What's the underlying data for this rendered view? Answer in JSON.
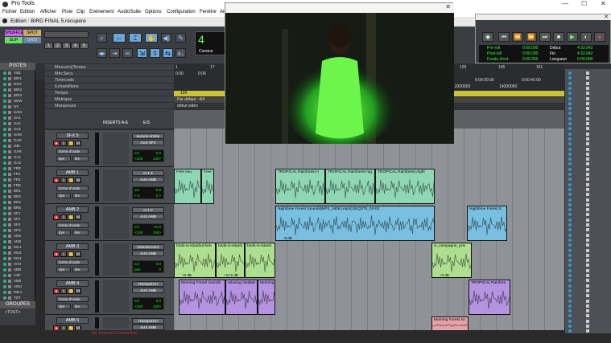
{
  "window": {
    "title": "Pro Tools",
    "controls": [
      "—",
      "☐",
      "✕"
    ]
  },
  "menu": [
    "Fichier",
    "Edition",
    "Afficher",
    "Piste",
    "Clip",
    "Evénement",
    "AudioSuite",
    "Options",
    "Configuration",
    "Fenêtre",
    "Aide"
  ],
  "edit_window": {
    "title": "Edition : BIRD FINAL 5.récupéré"
  },
  "toolbar": {
    "modes": [
      "SHUFFLE",
      "SPOT",
      "SLIP",
      "GRID"
    ],
    "zoom_presets": [
      "1",
      "2",
      "3",
      "4",
      "5"
    ],
    "counter_value": "4",
    "counter_label": "Curseur"
  },
  "tracks_panel": {
    "header": "PISTES",
    "tracks": [
      "Vid1",
      "BIR1",
      "DSG",
      "BIR2",
      "BIR3",
      "NEW",
      "NV",
      "SAM",
      "SA1",
      "SA2",
      "SA3",
      "SAM",
      "GAR",
      "GBI",
      "GAR",
      "GA1",
      "GA2",
      "FRE",
      "FR1",
      "FR2",
      "FRE",
      "BR1",
      "BR3",
      "BR4",
      "BRE",
      "SF1",
      "SF2",
      "SF4",
      "SFS",
      "AM1",
      "AM2",
      "MU1",
      "MU2",
      "MU3",
      "AVO",
      "ABR",
      "ASF",
      "AM0",
      "AMU",
      "Mar1",
      "TOT"
    ]
  },
  "groups_panel": {
    "header": "GROUPES",
    "item": "<TOUT>"
  },
  "rulers": [
    "Mesures|Temps",
    "Min:Secs",
    "Timecode",
    "Echantillons",
    "Tempo",
    "Métrique",
    "Marqueurs"
  ],
  "ruler_values": {
    "min_secs": [
      "0:00",
      "0:06"
    ],
    "sample_ticks": [
      "12000000",
      "14000000"
    ],
    "tempo": "120",
    "meter": "Par défaut : 4/4",
    "marker": "début vidéo",
    "bar_ticks": [
      "1",
      "17",
      "129",
      "145",
      "161"
    ],
    "time_ticks": [
      "0:00:30.00",
      "0:00:40.00"
    ]
  },
  "mix_headers": {
    "inserts": "INSERTS A-E",
    "io": "E/S"
  },
  "tracks": [
    {
      "name": "SFX 5",
      "io_in": "aucune entrée",
      "io_out": "AUX SFX",
      "wave": "forme d'onde",
      "dyn": "dyn",
      "mode": "lire",
      "vol": "vol",
      "vol_val": "0.0",
      "pan": "<100",
      "pan_r": "100>"
    },
    {
      "name": "AMB 1",
      "io_in": "In 1-2",
      "io_out": "AUX AMB",
      "wave": "forme d'onde",
      "dyn": "dyn",
      "mode": "lire",
      "vol": "vol",
      "vol_val": "-0.9",
      "pan": "< 0",
      "pan_r": "0 >"
    },
    {
      "name": "AMB 2",
      "io_in": "In 1-2",
      "io_out": "AUX AMB",
      "wave": "forme d'onde",
      "dyn": "dyn",
      "mode": "lire",
      "vol": "vol",
      "vol_val": "-11.9",
      "pan": "<100",
      "pan_r": "100>"
    },
    {
      "name": "AMB 3",
      "io_in": "<NoIntercom>",
      "io_out": "AUX AMB",
      "wave": "forme d'onde",
      "dyn": "dyn",
      "mode": "lire",
      "vol": "vol",
      "vol_val": "0.0",
      "pan": "pan",
      "pan_r": "0"
    },
    {
      "name": "AMB 4",
      "io_in": "<NoInput12>",
      "io_out": "AUX AMB",
      "wave": "forme d'onde",
      "dyn": "dyn",
      "mode": "lire",
      "vol": "vol",
      "vol_val": "0.0",
      "pan": "<100",
      "pan_r": "100>"
    },
    {
      "name": "AMB 5",
      "io_in": "<NoInput12>",
      "io_out": "AUX AMB",
      "wave": "",
      "dyn": "",
      "mode": "",
      "vol": "",
      "vol_val": "",
      "pan": "",
      "pan_r": ""
    }
  ],
  "clips": {
    "amb1": [
      "Free sou",
      "Free",
      "TROPICAL Rainforest n",
      "TROPICAL Rainforest nig",
      "TROPICAL Rainforest night"
    ],
    "amb2": [
      "Nighttime Forest Sounds(MP3_160K).mp3(1)EQ378_02-03",
      "Nighttime Forest S"
    ],
    "amb3": [
      "birds-in-istanbul-fore",
      "birds-in-istanb",
      "birds-in-istanb",
      "vi_campagne_prin"
    ],
    "amb4": [
      "Morning Forest sounds",
      "relaxing meditat",
      "Morning",
      "TROPICAL Rainfore"
    ],
    "amb5": [
      "Morning Forest so"
    ],
    "gain_labels": [
      "+0 dB",
      "+11.5 dB",
      "-9 dB",
      "+0 dB"
    ]
  },
  "transport": {
    "rows": [
      [
        "Pré-roll",
        "0:00.000",
        "Début",
        "4:32.042"
      ],
      [
        "Post-roll",
        "0:00.000",
        "Fin",
        "4:32.042"
      ],
      [
        "Fondu d'ent",
        "0:00.250",
        "Longueur",
        "0:00.000"
      ]
    ]
  },
  "status": "No Internet Connection",
  "colors": {
    "amb1": "#8fd6b4",
    "amb2": "#79bfe0",
    "amb3": "#aede8f",
    "amb4": "#b493e0",
    "amb5": "#e5a2a8",
    "accent": "#6aa7d8"
  }
}
